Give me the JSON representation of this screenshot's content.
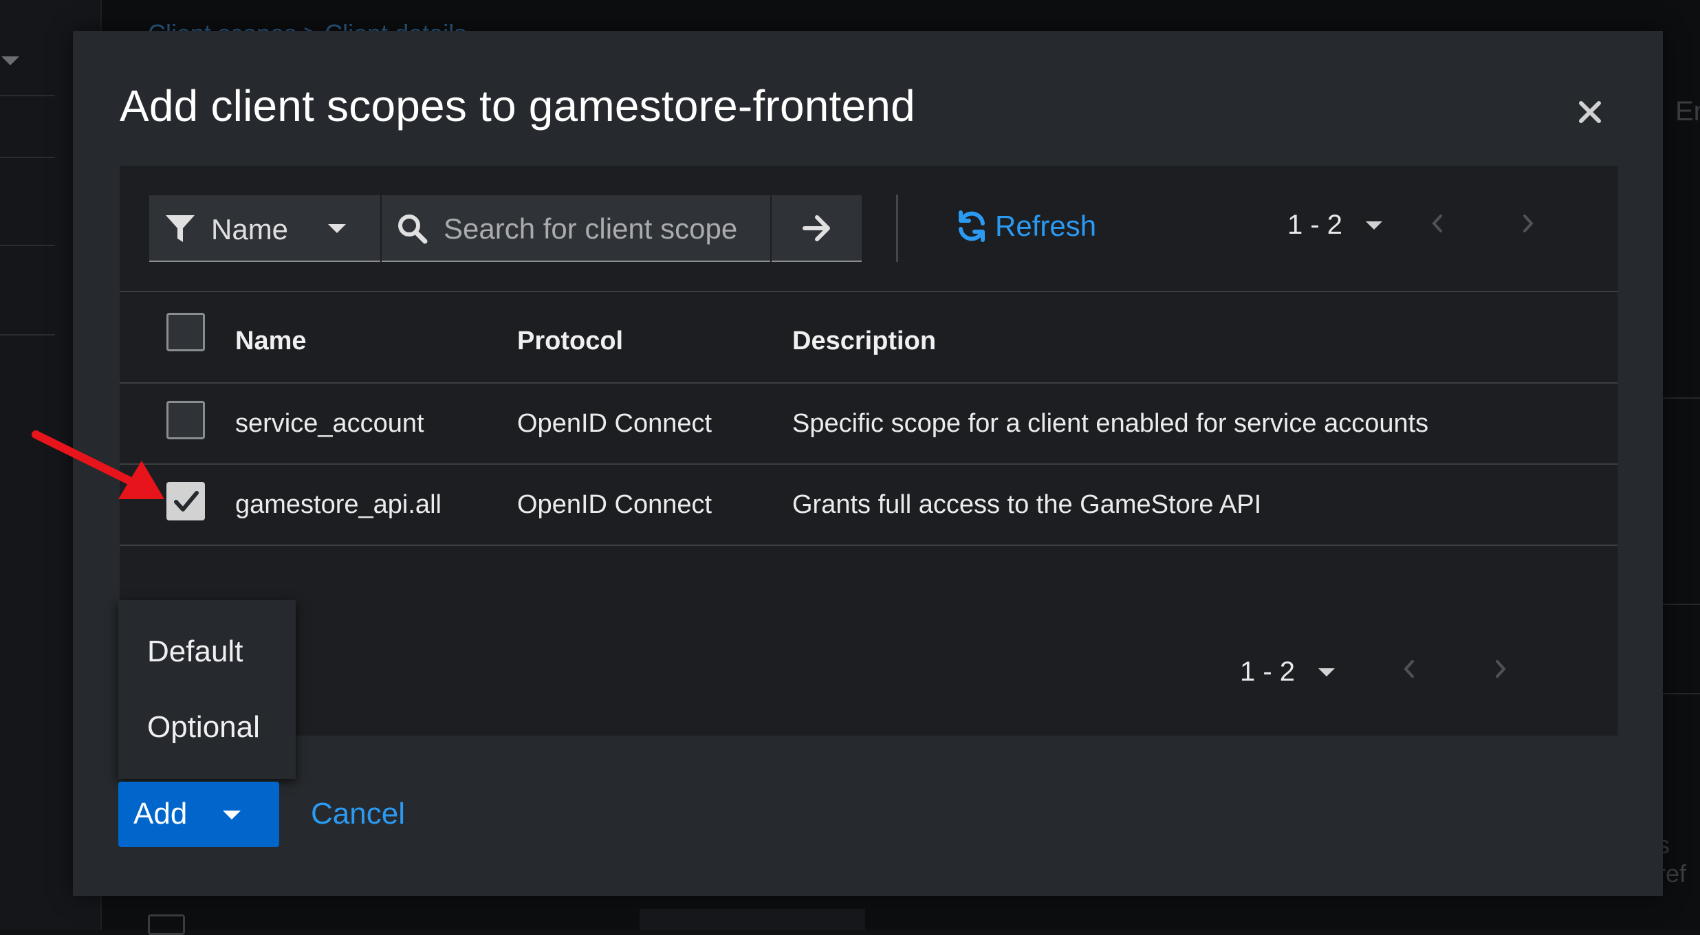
{
  "background": {
    "breadcrumb": "Client scopes > Client details",
    "right_text_top": "En",
    "right_text_bottom": "s ref"
  },
  "modal": {
    "title": "Add client scopes to gamestore-frontend",
    "close_icon": "close-icon"
  },
  "toolbar": {
    "filter_label": "Name",
    "filter_icon": "filter-icon",
    "search_placeholder": "Search for client scope",
    "search_icon": "search-icon",
    "go_icon": "arrow-right-icon",
    "refresh_label": "Refresh",
    "refresh_icon": "sync-icon",
    "pagination": "1 - 2"
  },
  "table": {
    "headers": [
      "Name",
      "Protocol",
      "Description"
    ],
    "rows": [
      {
        "name": "service_account",
        "protocol": "OpenID Connect",
        "description": "Specific scope for a client enabled for service accounts",
        "checked": false
      },
      {
        "name": "gamestore_api.all",
        "protocol": "OpenID Connect",
        "description": "Grants full access to the GameStore API",
        "checked": true
      }
    ]
  },
  "footer": {
    "pagination": "1 - 2",
    "add_menu": [
      "Default",
      "Optional"
    ],
    "add_label": "Add",
    "cancel_label": "Cancel"
  },
  "colors": {
    "accent": "#0066cc",
    "link": "#2b9af3",
    "annotation_arrow": "#e8141c"
  }
}
